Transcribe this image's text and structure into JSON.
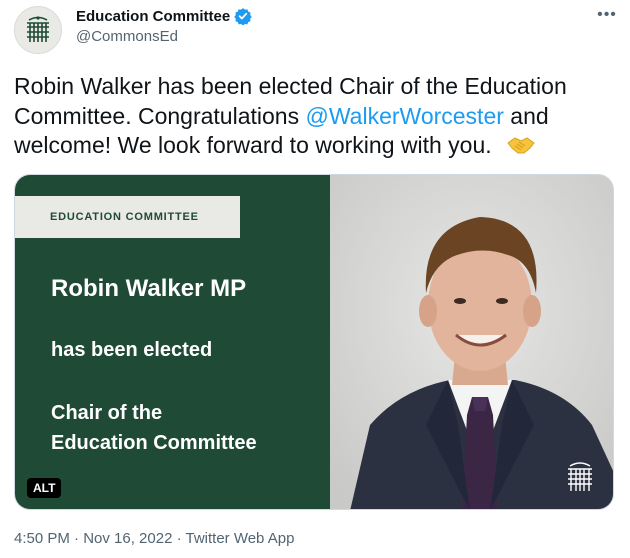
{
  "account": {
    "name": "Education Committee",
    "handle": "@CommonsEd",
    "verified": true,
    "avatar_icon": "portcullis-icon"
  },
  "menu": {
    "more_label": "•••"
  },
  "tweet": {
    "text_before": "Robin Walker has been elected Chair of the Education Committee. Congratulations ",
    "mention": "@WalkerWorcester",
    "text_after": " and welcome! We look forward to working with you.",
    "emoji_icon": "handshake-icon"
  },
  "media": {
    "label": "EDUCATION COMMITTEE",
    "headline": "Robin Walker MP",
    "line1": "has been elected",
    "line2a": "Chair of the",
    "line2b": "Education Committee",
    "alt_badge": "ALT",
    "photo_icon": "portcullis-icon"
  },
  "meta": {
    "timestamp": "4:50 PM · Nov 16, 2022 · Twitter Web App"
  },
  "colors": {
    "brand_green": "#1f4a35",
    "link": "#1d9bf0",
    "verified": "#1d9bf0"
  }
}
